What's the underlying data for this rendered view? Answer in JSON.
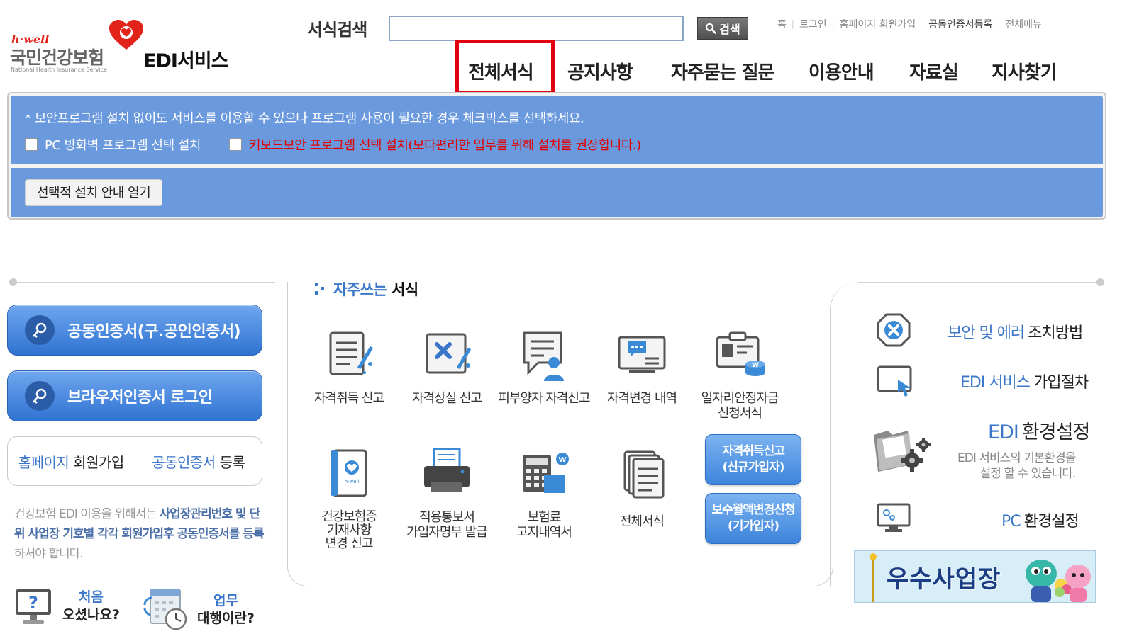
{
  "brand": {
    "hwell": "h·well",
    "org_name": "국민건강보험",
    "org_english": "National Health Insurance Service",
    "service_name": "EDI서비스",
    "accent": "#e2231a"
  },
  "search": {
    "label": "서식검색",
    "value": "",
    "button_label": "검색"
  },
  "util_links": [
    "홈",
    "로그인",
    "홈페이지 회원가입",
    "공동인증서등록",
    "전체메뉴"
  ],
  "gnb": {
    "items": [
      "전체서식",
      "공지사항",
      "자주묻는 질문",
      "이용안내",
      "자료실",
      "지사찾기"
    ],
    "highlighted": "전체서식"
  },
  "security": {
    "notice": "* 보안프로그램 설치 없이도 서비스를 이용할 수 있으나 프로그램 사용이 필요한 경우 체크박스를 선택하세요.",
    "firewall_option": "PC 방화벽 프로그램 선택 설치",
    "keyboard_option": "키보드보안 프로그램 선택 설치(보다편리한 업무를 위해 설치를 권장합니다.)",
    "guide_button": "선택적 설치 안내 열기",
    "bg_color": "#6b99dd"
  },
  "left": {
    "cert_login": "공동인증서(구.공인인증서)",
    "browser_login": "브라우저인증서 로그인",
    "join_blue": "홈페이지",
    "join_dark": "회원가입",
    "cert_reg_blue": "공동인증서",
    "cert_reg_dark": "등록",
    "note": {
      "p1": "건강보험 EDI 이용을 위해서는 ",
      "b1": "사업장관리번호 및 단위 사업장 기호별 각각 회원가입후 공동인증서를 등록",
      "p2": "하셔야 합니다."
    },
    "first_blue": "처음",
    "first_dark": "오셨나요?",
    "task_blue": "업무",
    "task_dark": "대행이란?"
  },
  "frequent": {
    "title_blue": "자주쓰는",
    "title_dark": "서식",
    "items": [
      {
        "label": "자격취득 신고",
        "icon": "document-pen-icon"
      },
      {
        "label": "자격상실 신고",
        "icon": "document-x-icon"
      },
      {
        "label": "피부양자\n자격신고",
        "icon": "speech-person-icon"
      },
      {
        "label": "자격변경 내역",
        "icon": "monitor-chat-icon"
      },
      {
        "label": "일자리안정자금\n신청서식",
        "icon": "id-card-coin-icon"
      },
      {
        "label": "건강보험증\n기재사항\n변경 신고",
        "icon": "health-card-icon"
      },
      {
        "label": "적용통보서\n가입자명부 발급",
        "icon": "printer-icon"
      },
      {
        "label": "보험료\n고지내역서",
        "icon": "calculator-icon"
      },
      {
        "label": "전체서식",
        "icon": "stacked-documents-icon"
      }
    ],
    "pills": [
      "자격취득신고\n(신규가입자)",
      "보수월액변경신청\n(기가입자)"
    ]
  },
  "right": {
    "error_blue": "보안 및 에러",
    "error_dark": "조치방법",
    "join_blue": "EDI 서비스",
    "join_dark": "가입절차",
    "env_blue": "EDI",
    "env_dark": "환경설정",
    "env_sub": "EDI 서비스의 기본환경을\n설정 할 수 있습니다.",
    "pc_blue": "PC",
    "pc_dark": "환경설정",
    "banner": "우수사업장"
  }
}
